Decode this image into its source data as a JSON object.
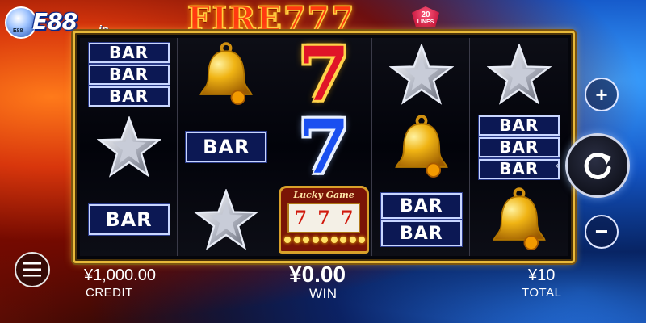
{
  "brand": {
    "logo_text": "E88",
    "logo_suffix": ".in",
    "badge_text": "E88"
  },
  "game": {
    "title": "FIRE777",
    "lines_count": "20",
    "lines_label": "LINES"
  },
  "reels": [
    [
      "bar-3",
      "star",
      "bar-1"
    ],
    [
      "bell",
      "bar-1",
      "star"
    ],
    [
      "seven-red",
      "seven-blue",
      "lucky-game"
    ],
    [
      "star",
      "bell",
      "bar-2"
    ],
    [
      "star",
      "bar-3",
      "bell"
    ]
  ],
  "symbols": {
    "bar_label": "BAR",
    "seven_label": "7",
    "lucky_game_label": "Lucky Game",
    "lucky_reel_glyph": "7"
  },
  "controls": {
    "plus_label": "+",
    "minus_label": "−",
    "spin_icon": "refresh-icon",
    "menu_icon": "menu-icon"
  },
  "info": {
    "credit_value": "¥1,000.00",
    "credit_label": "CREDIT",
    "win_value": "¥0.00",
    "win_label": "WIN",
    "total_value": "¥10",
    "total_label": "TOTAL"
  },
  "colors": {
    "frame_gold": "#e7b93a",
    "bar_blue": "#0c1854",
    "seven_red": "#e01428",
    "seven_blue": "#1a4ff0"
  }
}
